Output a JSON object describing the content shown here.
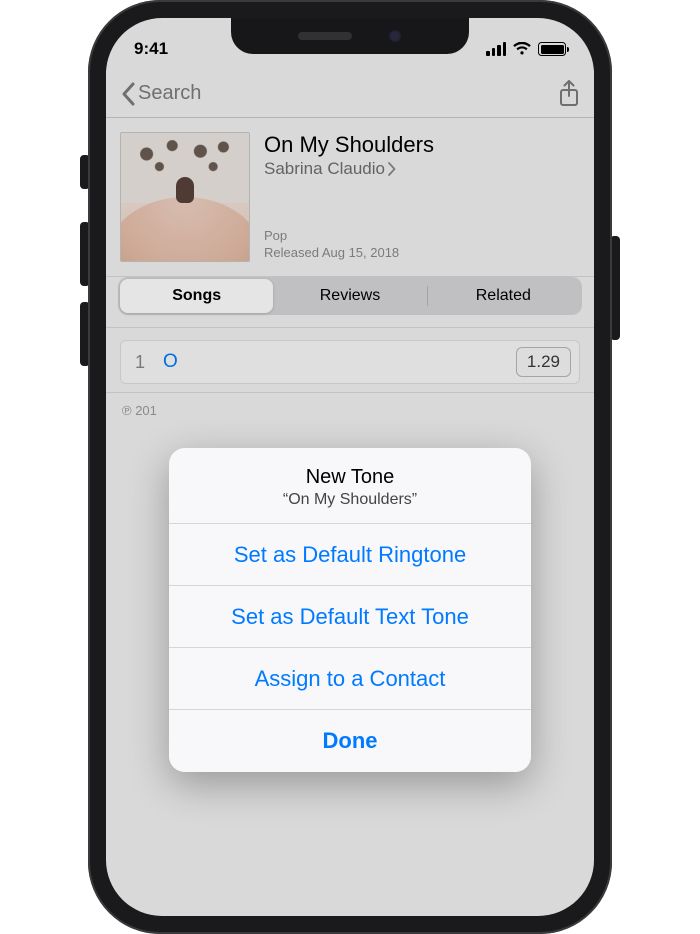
{
  "status_bar": {
    "time": "9:41"
  },
  "nav": {
    "back_label": "Search"
  },
  "item": {
    "title": "On My Shoulders",
    "artist": "Sabrina Claudio",
    "genre": "Pop",
    "release": "Released Aug 15, 2018"
  },
  "tabs": {
    "songs": "Songs",
    "reviews": "Reviews",
    "related": "Related"
  },
  "track": {
    "number": "1",
    "title_prefix": "O",
    "price_suffix": "1.29"
  },
  "footer": {
    "copyright_prefix": "℗ 201"
  },
  "sheet": {
    "title": "New Tone",
    "subtitle": "“On My Shoulders”",
    "set_ringtone": "Set as Default Ringtone",
    "set_texttone": "Set as Default Text Tone",
    "assign_contact": "Assign to a Contact",
    "done": "Done"
  }
}
